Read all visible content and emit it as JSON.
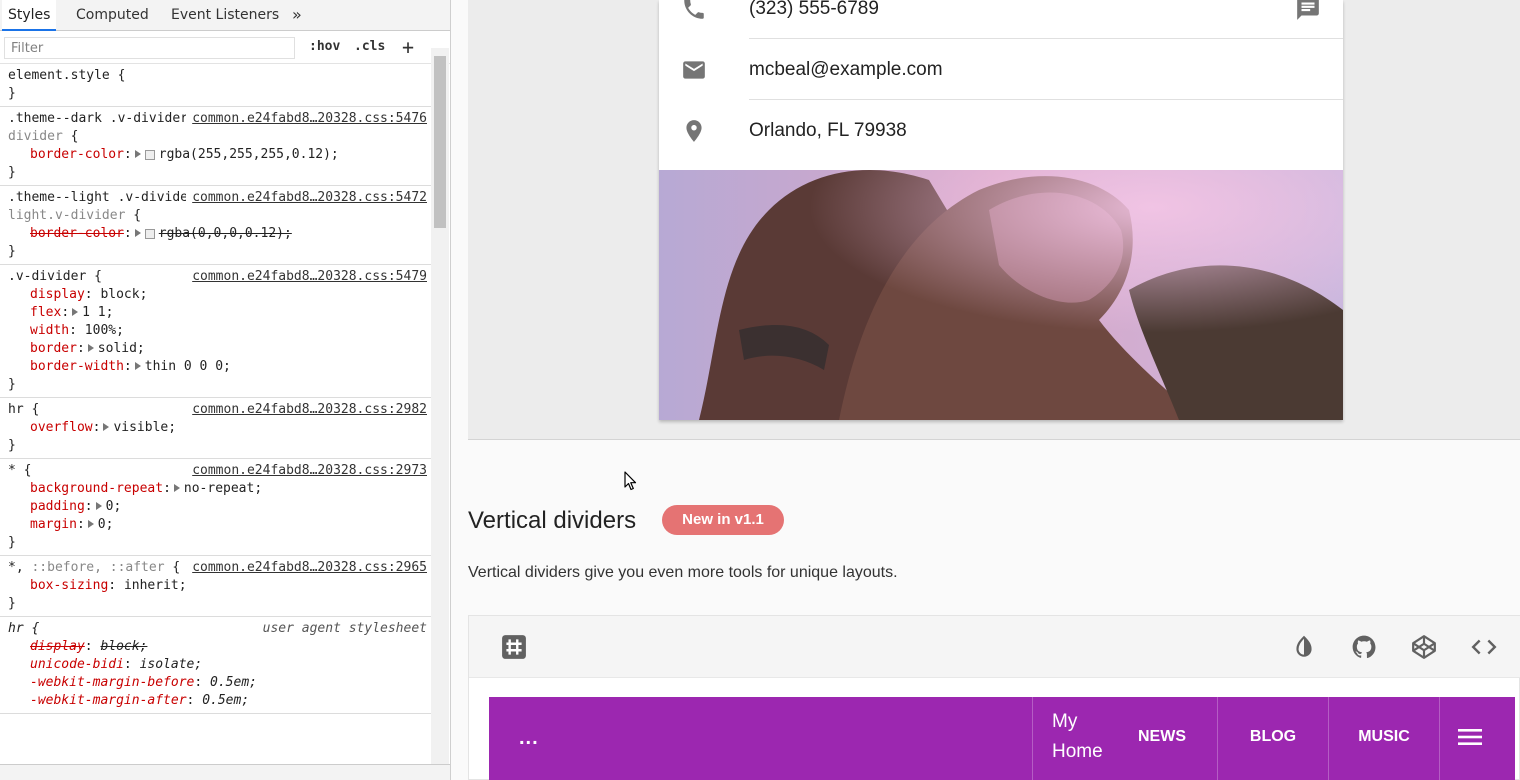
{
  "devtools": {
    "tabs": [
      "Styles",
      "Computed",
      "Event Listeners"
    ],
    "more_tabs_icon": "double-chevron-right-icon",
    "filter_placeholder": "Filter",
    "hov_label": ":hov",
    "cls_label": ".cls",
    "add_label": "+",
    "rules": [
      {
        "selector": "element.style {",
        "source": "",
        "decls": []
      },
      {
        "selector": ".theme--dark .v-divider, ",
        "selector_dim": ".application .theme--dark.v-divider",
        "selector_end": " {",
        "source": "common.e24fabd8…20328.css:5476",
        "decls": [
          {
            "prop": "border-color",
            "val": "rgba(255,255,255,0.12);",
            "swatch": true,
            "strike": false
          }
        ]
      },
      {
        "selector": ".theme--light .v-divider, ",
        "selector_dim": ".application .theme--light.v-divider",
        "selector_end": " {",
        "source": "common.e24fabd8…20328.css:5472",
        "decls": [
          {
            "prop": "border-color",
            "val": "rgba(0,0,0,0.12);",
            "swatch": true,
            "strike": true
          }
        ]
      },
      {
        "selector": ".v-divider {",
        "source": "common.e24fabd8…20328.css:5479",
        "decls": [
          {
            "prop": "display",
            "val": "block;"
          },
          {
            "prop": "flex",
            "val": "1 1;",
            "arrow": true
          },
          {
            "prop": "width",
            "val": "100%;"
          },
          {
            "prop": "border",
            "val": "solid;",
            "arrow": true
          },
          {
            "prop": "border-width",
            "val": "thin 0 0 0;",
            "arrow": true
          }
        ]
      },
      {
        "selector": "hr {",
        "source": "common.e24fabd8…20328.css:2982",
        "decls": [
          {
            "prop": "overflow",
            "val": "visible;",
            "arrow": true
          }
        ]
      },
      {
        "selector": "* {",
        "source": "common.e24fabd8…20328.css:2973",
        "decls": [
          {
            "prop": "background-repeat",
            "val": "no-repeat;",
            "arrow": true
          },
          {
            "prop": "padding",
            "val": "0;",
            "arrow": true
          },
          {
            "prop": "margin",
            "val": "0;",
            "arrow": true
          }
        ]
      },
      {
        "selector": "*, ",
        "selector_dim": "::before, ::after",
        "selector_end": " {",
        "source": "common.e24fabd8…20328.css:2965",
        "decls": [
          {
            "prop": "box-sizing",
            "val": "inherit;"
          }
        ]
      },
      {
        "selector": "hr {",
        "source": "user agent stylesheet",
        "ua": true,
        "decls": [
          {
            "prop": "display",
            "val": "block;",
            "strike": true
          },
          {
            "prop": "unicode-bidi",
            "val": "isolate;"
          },
          {
            "prop": "-webkit-margin-before",
            "val": "0.5em;"
          },
          {
            "prop": "-webkit-margin-after",
            "val": "0.5em;"
          }
        ]
      }
    ]
  },
  "card": {
    "phone": "(323) 555-6789",
    "email": "mcbeal@example.com",
    "location": "Orlando, FL 79938"
  },
  "section": {
    "title": "Vertical dividers",
    "badge": "New in v1.1",
    "description": "Vertical dividers give you even more tools for unique layouts."
  },
  "example_toolbar": {
    "left_icon": "hash-icon",
    "right_icons": [
      "invert-colors-icon",
      "github-icon",
      "codepen-icon",
      "code-icon"
    ]
  },
  "demo": {
    "dots": "...",
    "title": "My Home",
    "links": [
      "NEWS",
      "BLOG",
      "MUSIC"
    ],
    "menu_icon": "menu-icon",
    "color": "#9c27b0"
  }
}
